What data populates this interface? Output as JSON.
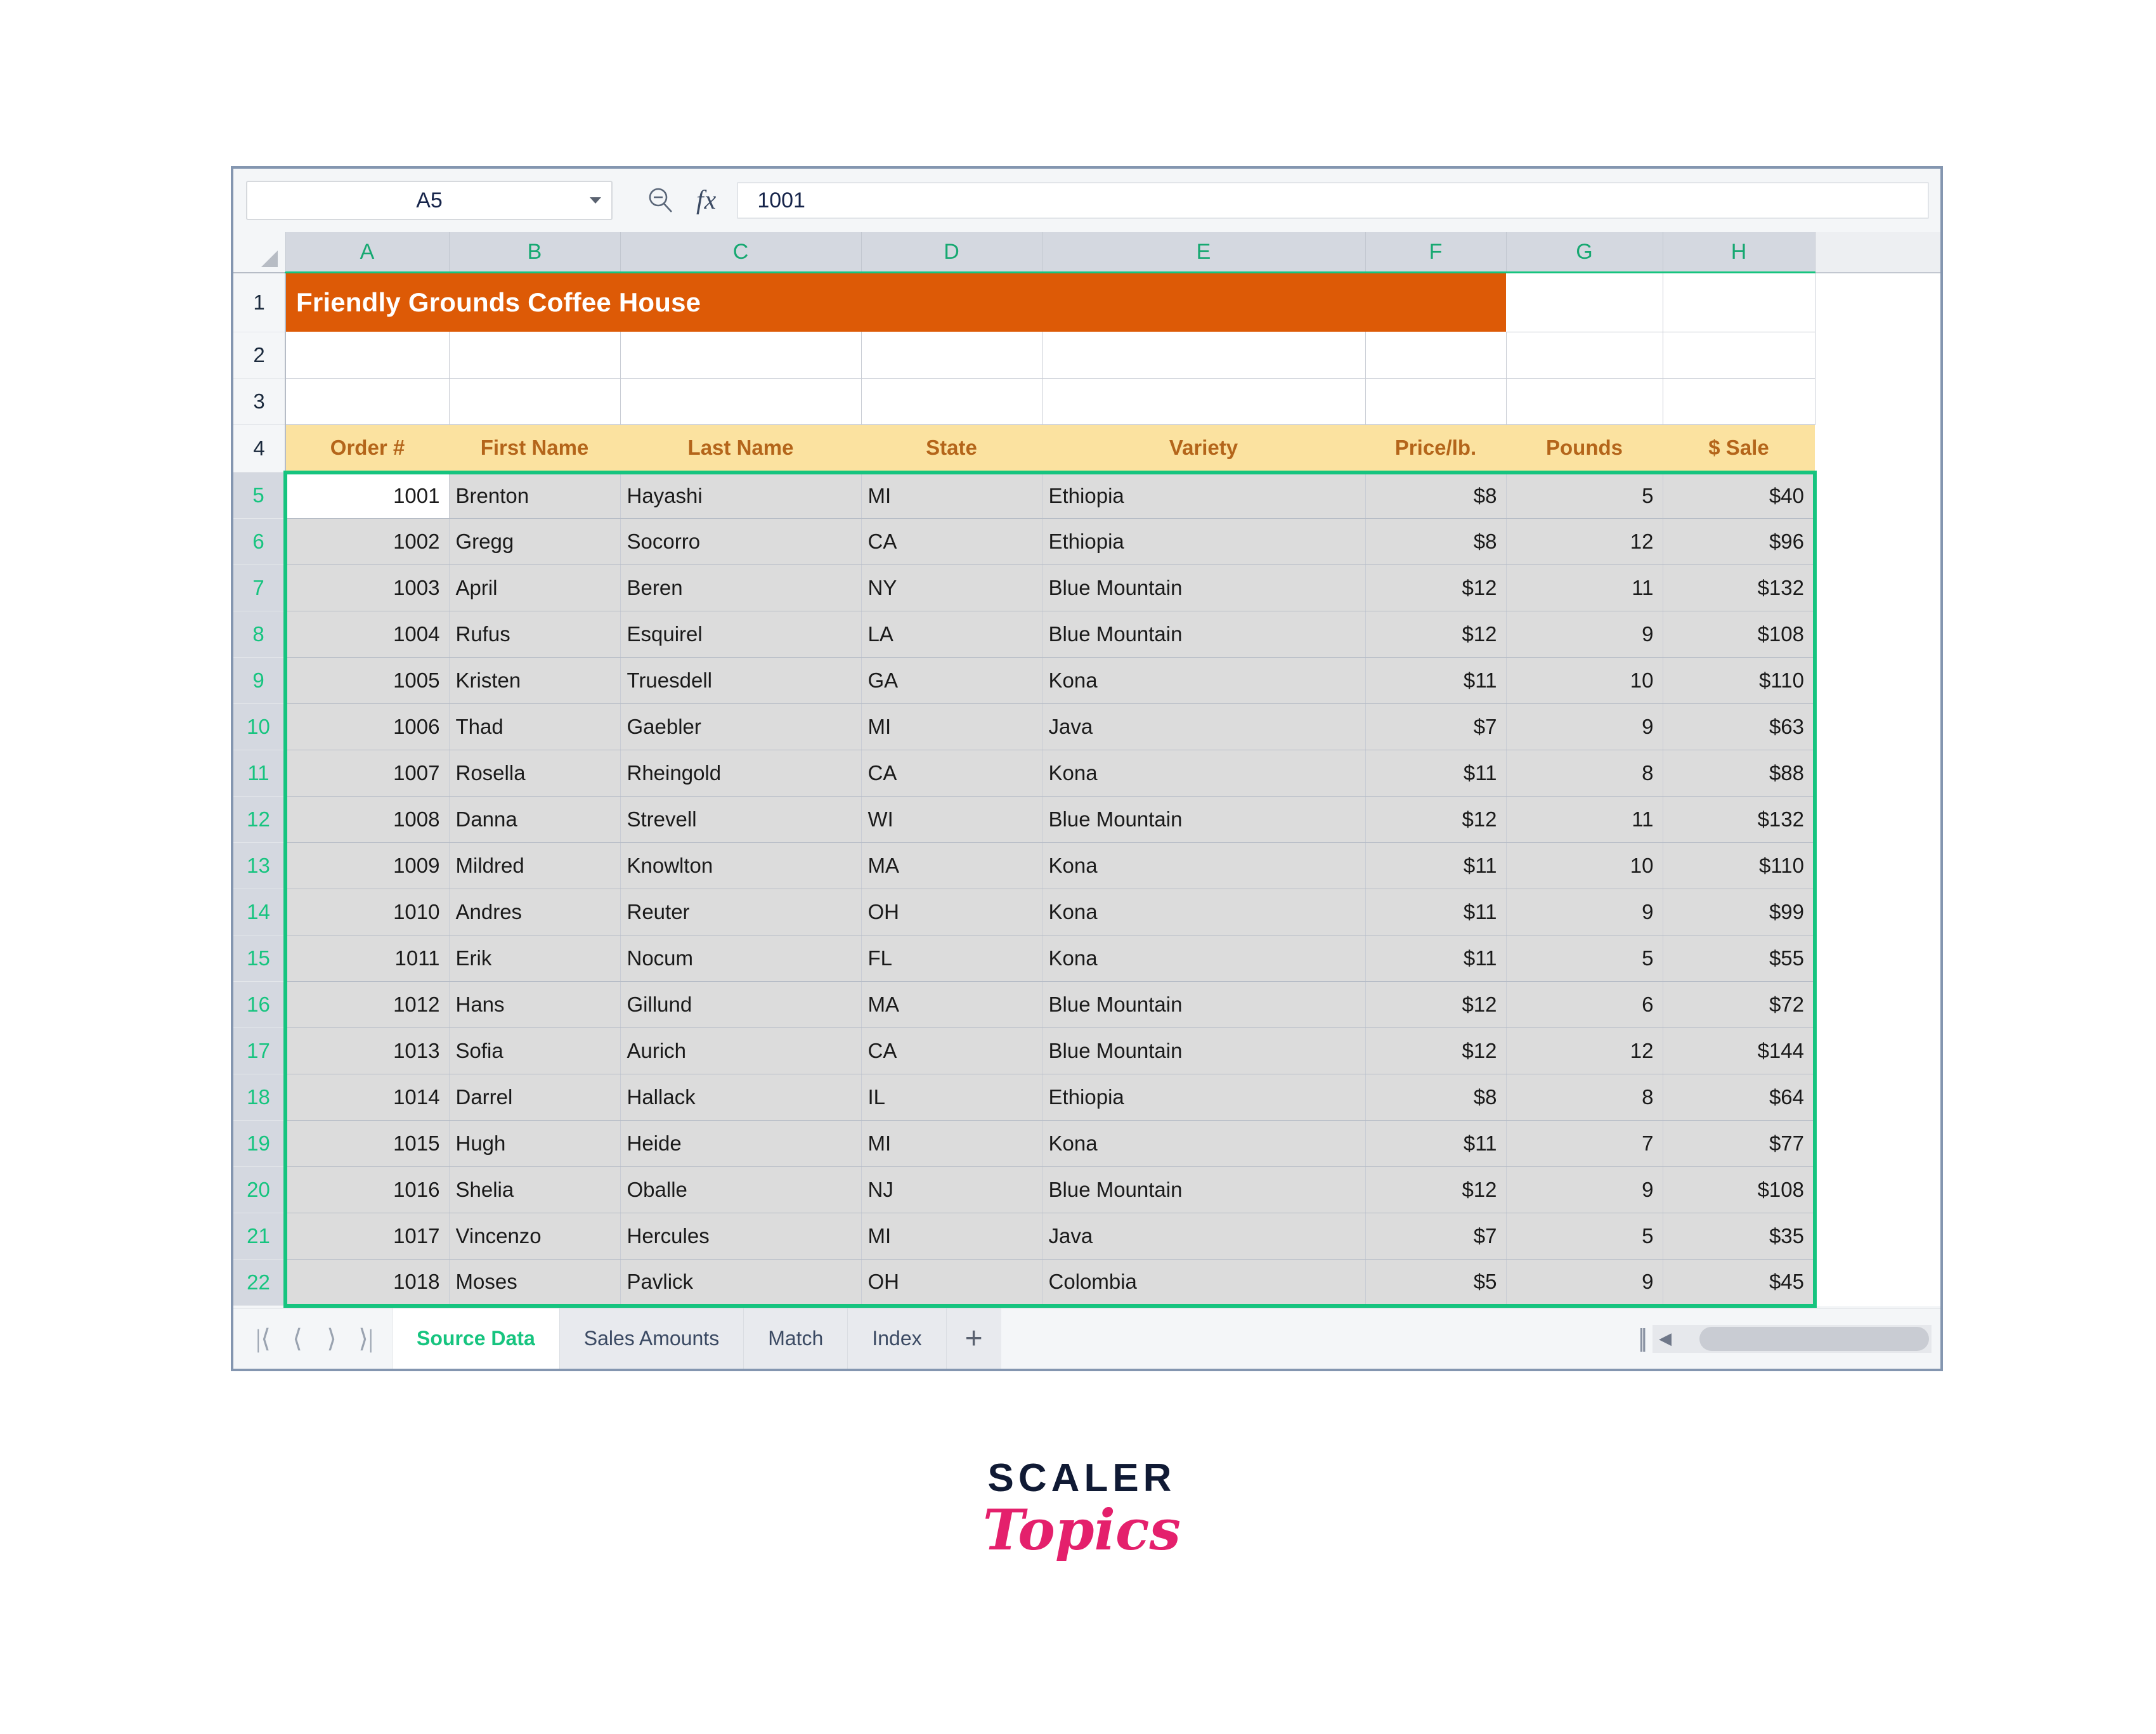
{
  "app": {
    "name_box_value": "A5",
    "name_box_placeholder": "Name Box",
    "fx_label": "fx",
    "formula_value": "1001",
    "zoom_icon": "search-icon",
    "dropdown_icon": "chevron-down-icon"
  },
  "grid": {
    "column_letters": [
      "A",
      "B",
      "C",
      "D",
      "E",
      "F",
      "G",
      "H"
    ],
    "row_numbers": [
      "1",
      "2",
      "3",
      "4",
      "5",
      "6",
      "7",
      "8",
      "9",
      "10",
      "11",
      "12",
      "13",
      "14",
      "15",
      "16",
      "17",
      "18",
      "19",
      "20",
      "21",
      "22"
    ],
    "title": "Friendly Grounds Coffee House",
    "headers": [
      "Order #",
      "First Name",
      "Last Name",
      "State",
      "Variety",
      "Price/lb.",
      "Pounds",
      "$ Sale"
    ],
    "selection_range_label": "A5:H22",
    "active_cell": "A5",
    "rows": [
      {
        "row": "5",
        "order": "1001",
        "first": "Brenton",
        "last": "Hayashi",
        "state": "MI",
        "variety": "Ethiopia",
        "price": "$8",
        "pounds": "5",
        "sale": "$40"
      },
      {
        "row": "6",
        "order": "1002",
        "first": "Gregg",
        "last": "Socorro",
        "state": "CA",
        "variety": "Ethiopia",
        "price": "$8",
        "pounds": "12",
        "sale": "$96"
      },
      {
        "row": "7",
        "order": "1003",
        "first": "April",
        "last": "Beren",
        "state": "NY",
        "variety": "Blue Mountain",
        "price": "$12",
        "pounds": "11",
        "sale": "$132"
      },
      {
        "row": "8",
        "order": "1004",
        "first": "Rufus",
        "last": "Esquirel",
        "state": "LA",
        "variety": "Blue Mountain",
        "price": "$12",
        "pounds": "9",
        "sale": "$108"
      },
      {
        "row": "9",
        "order": "1005",
        "first": "Kristen",
        "last": "Truesdell",
        "state": "GA",
        "variety": "Kona",
        "price": "$11",
        "pounds": "10",
        "sale": "$110"
      },
      {
        "row": "10",
        "order": "1006",
        "first": "Thad",
        "last": "Gaebler",
        "state": "MI",
        "variety": "Java",
        "price": "$7",
        "pounds": "9",
        "sale": "$63"
      },
      {
        "row": "11",
        "order": "1007",
        "first": "Rosella",
        "last": "Rheingold",
        "state": "CA",
        "variety": "Kona",
        "price": "$11",
        "pounds": "8",
        "sale": "$88"
      },
      {
        "row": "12",
        "order": "1008",
        "first": "Danna",
        "last": "Strevell",
        "state": "WI",
        "variety": "Blue Mountain",
        "price": "$12",
        "pounds": "11",
        "sale": "$132"
      },
      {
        "row": "13",
        "order": "1009",
        "first": "Mildred",
        "last": "Knowlton",
        "state": "MA",
        "variety": "Kona",
        "price": "$11",
        "pounds": "10",
        "sale": "$110"
      },
      {
        "row": "14",
        "order": "1010",
        "first": "Andres",
        "last": "Reuter",
        "state": "OH",
        "variety": "Kona",
        "price": "$11",
        "pounds": "9",
        "sale": "$99"
      },
      {
        "row": "15",
        "order": "1011",
        "first": "Erik",
        "last": "Nocum",
        "state": "FL",
        "variety": "Kona",
        "price": "$11",
        "pounds": "5",
        "sale": "$55"
      },
      {
        "row": "16",
        "order": "1012",
        "first": "Hans",
        "last": "Gillund",
        "state": "MA",
        "variety": "Blue Mountain",
        "price": "$12",
        "pounds": "6",
        "sale": "$72"
      },
      {
        "row": "17",
        "order": "1013",
        "first": "Sofia",
        "last": "Aurich",
        "state": "CA",
        "variety": "Blue Mountain",
        "price": "$12",
        "pounds": "12",
        "sale": "$144"
      },
      {
        "row": "18",
        "order": "1014",
        "first": "Darrel",
        "last": "Hallack",
        "state": "IL",
        "variety": "Ethiopia",
        "price": "$8",
        "pounds": "8",
        "sale": "$64"
      },
      {
        "row": "19",
        "order": "1015",
        "first": "Hugh",
        "last": "Heide",
        "state": "MI",
        "variety": "Kona",
        "price": "$11",
        "pounds": "7",
        "sale": "$77"
      },
      {
        "row": "20",
        "order": "1016",
        "first": "Shelia",
        "last": "Oballe",
        "state": "NJ",
        "variety": "Blue Mountain",
        "price": "$12",
        "pounds": "9",
        "sale": "$108"
      },
      {
        "row": "21",
        "order": "1017",
        "first": "Vincenzo",
        "last": "Hercules",
        "state": "MI",
        "variety": "Java",
        "price": "$7",
        "pounds": "5",
        "sale": "$35"
      },
      {
        "row": "22",
        "order": "1018",
        "first": "Moses",
        "last": "Pavlick",
        "state": "OH",
        "variety": "Colombia",
        "price": "$5",
        "pounds": "9",
        "sale": "$45"
      }
    ]
  },
  "tabbar": {
    "nav_first": "|⟨",
    "nav_prev": "⟨",
    "nav_next": "⟩",
    "nav_last": "⟩|",
    "sheets": [
      {
        "label": "Source Data",
        "active": true
      },
      {
        "label": "Sales Amounts",
        "active": false
      },
      {
        "label": "Match",
        "active": false
      },
      {
        "label": "Index",
        "active": false
      }
    ],
    "add_sheet_label": "+",
    "splitter": "||",
    "scroll_left_arrow": "◀"
  },
  "logo": {
    "primary": "SCALER",
    "secondary": "Topics"
  },
  "colors": {
    "title_banner": "#dd5a06",
    "header_fill": "#fbe2a0",
    "header_text": "#b4651a",
    "selection_green": "#16c47f",
    "selected_fill": "#dcdcdc",
    "col_header_fill": "#d4d8e0",
    "logo_primary": "#101a34",
    "logo_secondary": "#e4206c"
  }
}
